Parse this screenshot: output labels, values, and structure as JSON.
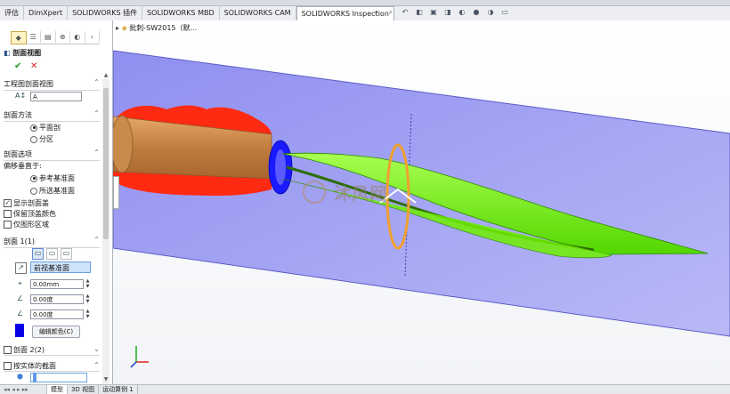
{
  "tabs": [
    "评估",
    "DimXpert",
    "SOLIDWORKS 插件",
    "SOLIDWORKS MBD",
    "SOLIDWORKS CAM",
    "SOLIDWORKS Inspection"
  ],
  "active_tab_index": 5,
  "feature_tree": {
    "root": "批刺-SW2015（默..."
  },
  "panel": {
    "title": "剖面视图",
    "ok_icon": "check-icon",
    "cancel_icon": "x-icon",
    "section_view": {
      "title": "工程图剖面视图",
      "label_value": "A"
    },
    "method": {
      "title": "剖面方法",
      "options": [
        "平面剖",
        "分区"
      ],
      "selected": 0
    },
    "options": {
      "title": "剖面选项",
      "offset_label": "偏移垂直于:",
      "offset_options": [
        "参考基准面",
        "所选基准面"
      ],
      "offset_selected": 0,
      "checks": [
        {
          "label": "显示剖面盖",
          "checked": true
        },
        {
          "label": "保留顶盖颜色",
          "checked": false
        },
        {
          "label": "仅图形区域",
          "checked": false
        }
      ]
    },
    "section1": {
      "title": "剖面 1(1)",
      "plane": "前视基准面",
      "distance": "0.00mm",
      "angle1": "0.00度",
      "angle2": "0.00度",
      "edit_color": "编辑颜色(C)",
      "cap_color": "#0a00e6"
    },
    "section2": {
      "title": "剖面 2(2)",
      "checked": false
    },
    "by_body": {
      "title": "按实体的截面",
      "checked": false
    }
  },
  "bottom_tabs": [
    "模型",
    "3D 视图",
    "运动算例 1"
  ],
  "watermark": "沐风网",
  "colors": {
    "plane": "#9d9df2",
    "handle_body": "#c98a4a",
    "handle_fins": "#ff2a12",
    "blade": "#7dff1c",
    "guard": "#1a1aff"
  }
}
